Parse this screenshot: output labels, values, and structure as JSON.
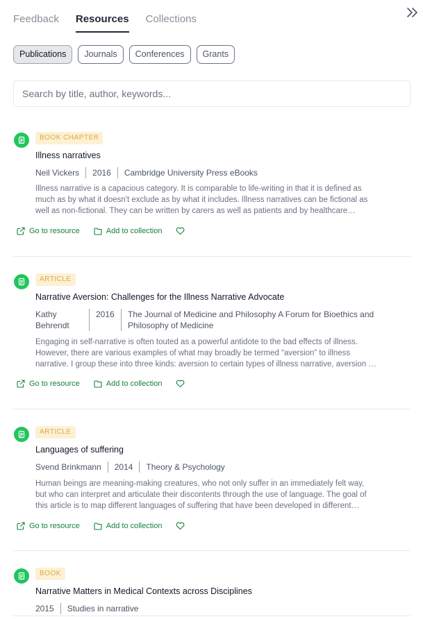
{
  "tabs": [
    {
      "label": "Feedback",
      "active": false
    },
    {
      "label": "Resources",
      "active": true
    },
    {
      "label": "Collections",
      "active": false
    }
  ],
  "collapse_icon": "chevrons-right-icon",
  "filters": [
    {
      "label": "Publications",
      "active": true
    },
    {
      "label": "Journals",
      "active": false
    },
    {
      "label": "Conferences",
      "active": false
    },
    {
      "label": "Grants",
      "active": false
    }
  ],
  "search": {
    "placeholder": "Search by title, author, keywords..."
  },
  "actions": {
    "go": "Go to resource",
    "add": "Add to collection"
  },
  "colors": {
    "accent": "#22c55e",
    "badge_bg": "#fdf1d4",
    "badge_text": "#d8a94a",
    "action": "#15803d"
  },
  "results": [
    {
      "type": "BOOK CHAPTER",
      "title": "Illness narratives",
      "author": "Neil Vickers",
      "year": "2016",
      "source": "Cambridge University Press eBooks",
      "abstract": "Illness narrative is a capacious category. It is comparable to life-writing in that it is defined as much as by what it doesn't exclude as by what it includes. Illness narratives can be fictional as well as non-fictional. They can be written by carers as well as patients and by healthcare professionals."
    },
    {
      "type": "ARTICLE",
      "title": "Narrative Aversion: Challenges for the Illness Narrative Advocate",
      "author": "Kathy Behrendt",
      "year": "2016",
      "source": "The Journal of Medicine and Philosophy A Forum for Bioethics and Philosophy of Medicine",
      "abstract": "Engaging in self-narrative is often touted as a powerful antidote to the bad effects of illness. However, there are various examples of what may broadly be termed “aversion” to illness narrative. I group these into three kinds: aversion to certain types of illness narrative, aversion to the act of narrating."
    },
    {
      "type": "ARTICLE",
      "title": "Languages of suffering",
      "author": "Svend Brinkmann",
      "year": "2014",
      "source": "Theory & Psychology",
      "abstract": "Human beings are meaning-making creatures, who not only suffer in an immediately felt way, but who can interpret and articulate their discontents through the use of language. The goal of this article is to map different languages of suffering that have been developed in different cultures."
    },
    {
      "type": "BOOK",
      "title": "Narrative Matters in Medical Contexts across Disciplines",
      "year": "2015",
      "source": "Studies in narrative"
    }
  ]
}
